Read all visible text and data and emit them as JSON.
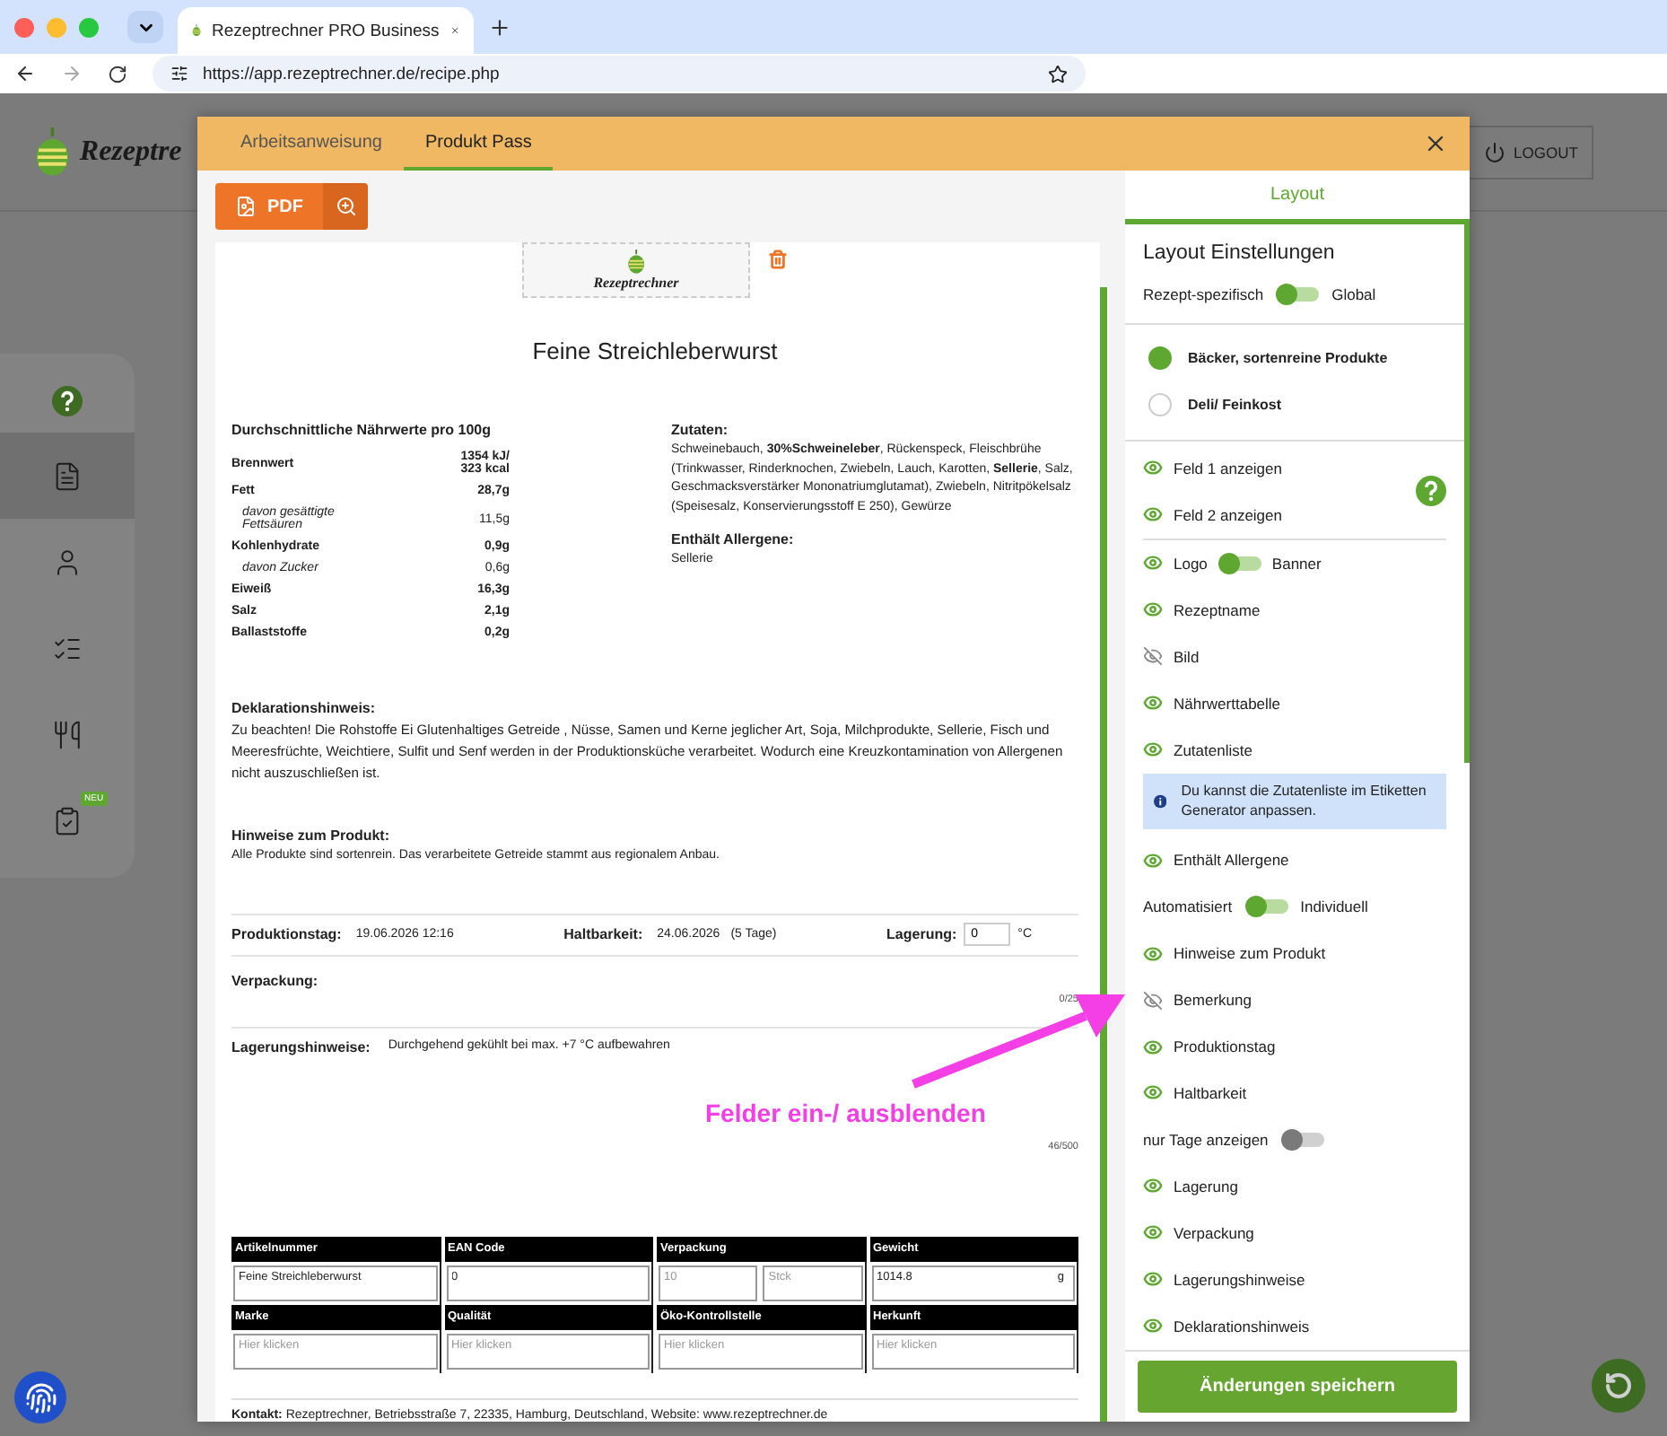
{
  "browser": {
    "tab_title": "Rezeptrechner PRO Business",
    "url": "https://app.rezeptrechner.de/recipe.php"
  },
  "app": {
    "logo": "Rezeptre",
    "logout": "LOGOUT",
    "sidebar": [
      {
        "kind": "help",
        "selected": false
      },
      {
        "kind": "document",
        "selected": true
      },
      {
        "kind": "person",
        "selected": false
      },
      {
        "kind": "checklist",
        "selected": false
      },
      {
        "kind": "dinner",
        "selected": false
      },
      {
        "kind": "clipboard",
        "selected": false,
        "badge": "NEU"
      }
    ]
  },
  "modal": {
    "tabs": [
      {
        "label": "Arbeitsanweisung",
        "selected": false
      },
      {
        "label": "Produkt Pass",
        "selected": true
      }
    ],
    "pdf_button": "PDF",
    "document": {
      "logo": "Rezeptrechner",
      "title": "Feine Streichleberwurst",
      "nutrition": {
        "heading": "Durchschnittliche Nährwerte pro 100g",
        "rows": [
          {
            "kind": "main",
            "label": "Brennwert",
            "value": "1354 kJ/ 323 kcal"
          },
          {
            "kind": "main",
            "label": "Fett",
            "value": "28,7g"
          },
          {
            "kind": "sub",
            "label": "davon gesättigte Fettsäuren",
            "value": "11,5g"
          },
          {
            "kind": "main",
            "label": "Kohlenhydrate",
            "value": "0,9g"
          },
          {
            "kind": "sub",
            "label": "davon Zucker",
            "value": "0,6g"
          },
          {
            "kind": "main",
            "label": "Eiweiß",
            "value": "16,3g"
          },
          {
            "kind": "main",
            "label": "Salz",
            "value": "2,1g"
          },
          {
            "kind": "main",
            "label": "Ballaststoffe",
            "value": "0,2g"
          }
        ]
      },
      "ingredients": {
        "heading": "Zutaten:",
        "text": "Schweinebauch, **30%Schweineleber**, Rückenspeck, Fleischbrühe (Trinkwasser, Rinderknochen, Zwiebeln, Lauch, Karotten, **Sellerie**, Salz, Geschmacksverstärker Mononatriumglutamat), Zwiebeln, Nitritpökelsalz (Speisesalz, Konservierungsstoff E 250), Gewürze"
      },
      "allergens": {
        "heading": "Enthält Allergene:",
        "text": "Sellerie"
      },
      "declaration": {
        "heading": "Deklarationshinweis:",
        "text": "Zu beachten! Die Rohstoffe Ei Glutenhaltiges Getreide , Nüsse, Samen und Kerne jeglicher Art, Soja, Milchprodukte, Sellerie, Fisch und Meeresfrüchte, Weichtiere, Sulfit und Senf werden in der Produktionsküche verarbeitet. Wodurch eine Kreuzkontamination von Allergenen nicht auszuschließen ist."
      },
      "product_notes": {
        "heading": "Hinweise zum Produkt:",
        "text": "Alle Produkte sind sortenrein. Das verarbeitete Getreide stammt aus regionalem Anbau."
      },
      "production": {
        "label": "Produktionstag:",
        "value": "19.06.2026 12:16"
      },
      "shelf_life": {
        "label": "Haltbarkeit:",
        "value": "24.06.2026",
        "days": "(5 Tage)"
      },
      "storage": {
        "label": "Lagerung:",
        "value": "0",
        "unit": "°C"
      },
      "packaging": {
        "label": "Verpackung:",
        "counter": "0/25"
      },
      "storage_notes": {
        "label": "Lagerungshinweise:",
        "text": "Durchgehend gekühlt bei max. +7 °C aufbewahren",
        "counter": "46/500"
      },
      "product_table": [
        [
          {
            "heading": "Artikelnummer",
            "fields": [
              {
                "value": "Feine Streichleberwurst"
              }
            ]
          },
          {
            "heading": "EAN Code",
            "fields": [
              {
                "value": "0"
              }
            ]
          },
          {
            "heading": "Verpackung",
            "fields": [
              {
                "placeholder": "10"
              },
              {
                "placeholder": "Stck"
              }
            ]
          },
          {
            "heading": "Gewicht",
            "fields": [
              {
                "value": "1014.8",
                "unit": "g"
              }
            ]
          }
        ],
        [
          {
            "heading": "Marke",
            "fields": [
              {
                "placeholder": "Hier klicken"
              }
            ]
          },
          {
            "heading": "Qualität",
            "fields": [
              {
                "placeholder": "Hier klicken"
              }
            ]
          },
          {
            "heading": "Öko-Kontrollstelle",
            "fields": [
              {
                "placeholder": "Hier klicken"
              }
            ]
          },
          {
            "heading": "Herkunft",
            "fields": [
              {
                "placeholder": "Hier klicken"
              }
            ]
          }
        ]
      ],
      "contact": "**Kontakt:** Rezeptrechner, Betriebsstraße 7, 22335, Hamburg, Deutschland, Website: www.rezeptrechner.de"
    },
    "layout": {
      "tab": "Layout",
      "heading": "Layout Einstellungen",
      "scope": {
        "left": "Rezept-spezifisch",
        "right": "Global",
        "on": true
      },
      "presets": [
        {
          "label": "Bäcker, sortenreine Produkte",
          "selected": true
        },
        {
          "label": "Deli/ Feinkost",
          "selected": false
        }
      ],
      "fields_group": [
        {
          "label": "Feld 1 anzeigen",
          "visible": true
        },
        {
          "label": "Feld 2 anzeigen",
          "visible": true
        }
      ],
      "items": [
        {
          "kind": "field_switch",
          "label": "Logo",
          "right": "Banner",
          "visible": true,
          "on": true
        },
        {
          "kind": "field",
          "label": "Rezeptname",
          "visible": true
        },
        {
          "kind": "field",
          "label": "Bild",
          "visible": false
        },
        {
          "kind": "field",
          "label": "Nährwerttabelle",
          "visible": true
        },
        {
          "kind": "field",
          "label": "Zutatenliste",
          "visible": true
        },
        {
          "kind": "info",
          "text": "Du kannst die Zutatenliste im Etiketten Generator anpassen."
        },
        {
          "kind": "field",
          "label": "Enthält Allergene",
          "visible": true
        },
        {
          "kind": "switch",
          "left": "Automatisiert",
          "right": "Individuell",
          "on": true
        },
        {
          "kind": "field",
          "label": "Hinweise zum Produkt",
          "visible": true
        },
        {
          "kind": "field",
          "label": "Bemerkung",
          "visible": false
        },
        {
          "kind": "field",
          "label": "Produktionstag",
          "visible": true
        },
        {
          "kind": "field",
          "label": "Haltbarkeit",
          "visible": true
        },
        {
          "kind": "switch",
          "left": "nur Tage anzeigen",
          "on": false
        },
        {
          "kind": "field",
          "label": "Lagerung",
          "visible": true
        },
        {
          "kind": "field",
          "label": "Verpackung",
          "visible": true
        },
        {
          "kind": "field",
          "label": "Lagerungshinweise",
          "visible": true
        },
        {
          "kind": "field",
          "label": "Deklarationshinweis",
          "visible": true
        }
      ],
      "save": "Änderungen speichern"
    }
  },
  "annotation": "Felder ein-/ ausblenden"
}
